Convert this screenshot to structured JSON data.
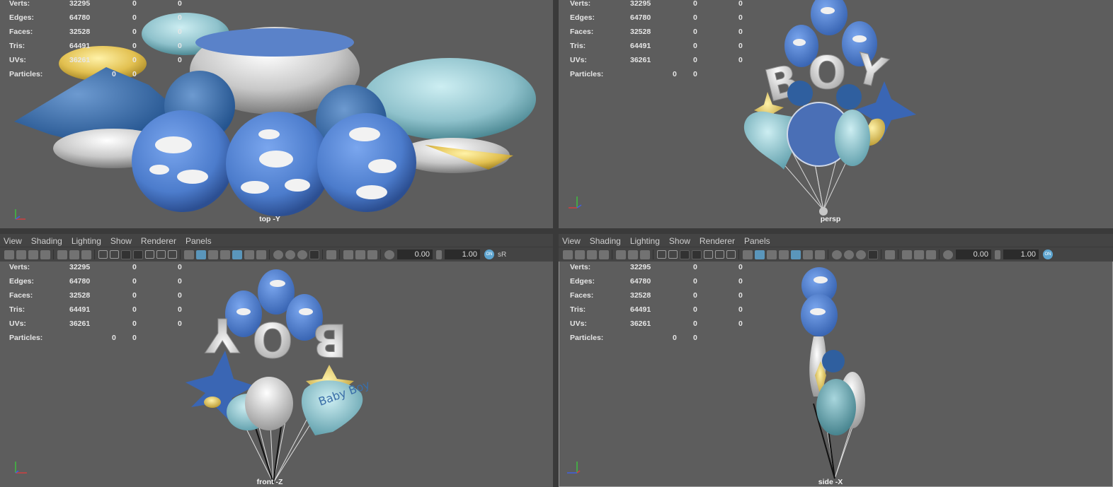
{
  "app": {
    "name": "Maya 4-view viewport"
  },
  "menu": [
    "View",
    "Shading",
    "Lighting",
    "Show",
    "Renderer",
    "Panels"
  ],
  "toolbar": {
    "exposure": "0.00",
    "gamma": "1.00",
    "srgb": "sR",
    "toggle": "ON"
  },
  "hud_labels": {
    "verts": "Verts:",
    "edges": "Edges:",
    "faces": "Faces:",
    "tris": "Tris:",
    "uvs": "UVs:",
    "particles": "Particles:"
  },
  "stats": {
    "verts": [
      "32295",
      "0",
      "0"
    ],
    "edges": [
      "64780",
      "0",
      "0"
    ],
    "faces": [
      "32528",
      "0",
      "0"
    ],
    "tris": [
      "64491",
      "0",
      "0"
    ],
    "uvs": [
      "36261",
      "0",
      "0"
    ],
    "particles": [
      "0",
      "0"
    ]
  },
  "viewports": [
    {
      "camera": "top -Y"
    },
    {
      "camera": "persp"
    },
    {
      "camera": "front -Z"
    },
    {
      "camera": "side -X"
    }
  ],
  "colors": {
    "viewport_bg": "#5d5d5d",
    "panel_bg": "#444444",
    "accent": "#5ea5d0",
    "balloon_blue": "#4f7fcf",
    "balloon_teal": "#8fc6cf",
    "balloon_silver": "#d9d9d9",
    "balloon_gold": "#e0c050"
  },
  "balloon_text": {
    "heart": "Baby Boy",
    "letters": [
      "B",
      "O",
      "Y"
    ]
  }
}
